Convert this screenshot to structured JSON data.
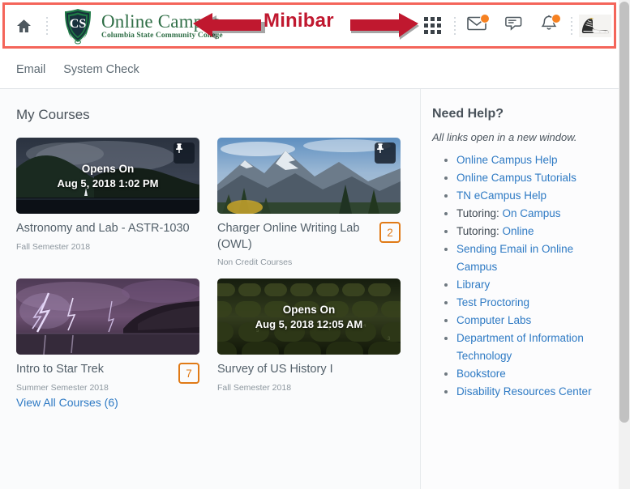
{
  "minibar": {
    "home_icon": "home-icon",
    "brand": {
      "logo_icon": "columbia-state-shield-logo",
      "title": "Online Campus",
      "subtitle": "Columbia State Community College"
    },
    "annotation": {
      "label": "Minibar",
      "color": "#c0182f",
      "left_arrow_icon": "arrow-left-icon",
      "right_arrow_icon": "arrow-right-icon",
      "highlight_color": "#f4655a"
    },
    "icons": [
      {
        "name": "course-selector-waffle-icon",
        "label": "Select a course",
        "badge": false
      },
      {
        "name": "email-icon",
        "label": "Email",
        "badge": true
      },
      {
        "name": "subscription-alerts-icon",
        "label": "Subscription Alerts",
        "badge": false
      },
      {
        "name": "update-alerts-bell-icon",
        "label": "Update Alerts",
        "badge": true
      },
      {
        "name": "profile-avatar",
        "label": "Personal Menu",
        "badge": false
      }
    ],
    "badge_color": "#f68121"
  },
  "navbar": {
    "items": [
      {
        "label": "Email"
      },
      {
        "label": "System Check"
      }
    ]
  },
  "courses_panel": {
    "title": "My Courses",
    "view_all_label": "View All Courses (6)",
    "cards": [
      {
        "title": "Astronomy and Lab - ASTR-1030",
        "semester": "Fall Semester 2018",
        "opens_on_label": "Opens On",
        "opens_on_date": "Aug 5, 2018 1:02 PM",
        "pinned": true,
        "badge": "",
        "image": "coastal-cliffs-night"
      },
      {
        "title": "Charger Online Writing Lab (OWL)",
        "semester": "Non Credit Courses",
        "opens_on_label": "",
        "opens_on_date": "",
        "pinned": true,
        "badge": "2",
        "image": "mountain-range-daylight"
      },
      {
        "title": "Intro to Star Trek",
        "semester": "Summer Semester 2018",
        "opens_on_label": "",
        "opens_on_date": "",
        "pinned": false,
        "badge": "7",
        "image": "lightning-storm-coast"
      },
      {
        "title": "Survey of US History I",
        "semester": "Fall Semester 2018",
        "opens_on_label": "Opens On",
        "opens_on_date": "Aug 5, 2018 12:05 AM",
        "pinned": false,
        "badge": "",
        "image": "auditorium-seats"
      }
    ],
    "badge_color": "#e07a16",
    "link_color": "#2e7ac4"
  },
  "help_panel": {
    "title": "Need Help?",
    "note": "All links open in a new window.",
    "links": [
      {
        "prefix": "",
        "label": "Online Campus Help"
      },
      {
        "prefix": "",
        "label": "Online Campus Tutorials"
      },
      {
        "prefix": "",
        "label": "TN eCampus Help"
      },
      {
        "prefix": "Tutoring: ",
        "label": "On Campus"
      },
      {
        "prefix": "Tutoring: ",
        "label": "Online"
      },
      {
        "prefix": "",
        "label": "Sending Email in Online Campus"
      },
      {
        "prefix": "",
        "label": "Library"
      },
      {
        "prefix": "",
        "label": "Test Proctoring"
      },
      {
        "prefix": "",
        "label": "Computer Labs"
      },
      {
        "prefix": "",
        "label": "Department of Information Technology"
      },
      {
        "prefix": "",
        "label": "Bookstore"
      },
      {
        "prefix": "",
        "label": "Disability Resources Center"
      }
    ]
  }
}
